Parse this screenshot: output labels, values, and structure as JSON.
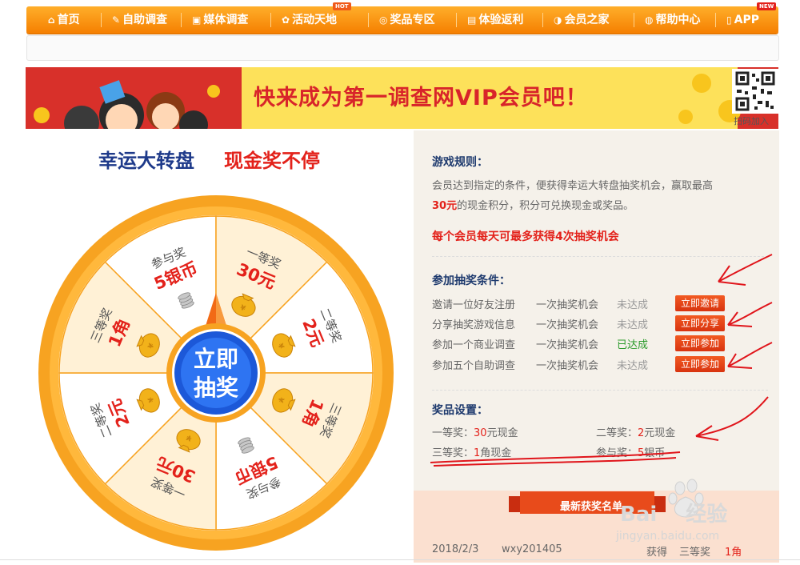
{
  "nav": {
    "items": [
      {
        "label": "首页",
        "icon": "home-icon"
      },
      {
        "label": "自助调查",
        "icon": "pencil-icon"
      },
      {
        "label": "媒体调查",
        "icon": "tv-icon"
      },
      {
        "label": "活动天地",
        "icon": "gift-icon",
        "badge": "HOT"
      },
      {
        "label": "奖品专区",
        "icon": "coins-icon"
      },
      {
        "label": "体验返利",
        "icon": "wallet-icon"
      },
      {
        "label": "会员之家",
        "icon": "members-icon"
      },
      {
        "label": "帮助中心",
        "icon": "help-icon"
      },
      {
        "label": "APP",
        "icon": "phone-icon",
        "badge": "NEW"
      }
    ]
  },
  "banner": {
    "headline": "快来成为第一调查网VIP会员吧！",
    "qr_caption": "扫码加入"
  },
  "wheel": {
    "title": "幸运大转盘",
    "slogan": "现金奖不停",
    "center_button": [
      "立即",
      "抽奖"
    ],
    "segments": [
      {
        "tier": "参与奖",
        "prize": "5银币"
      },
      {
        "tier": "一等奖",
        "prize": "30元"
      },
      {
        "tier": "二等奖",
        "prize": "2元"
      },
      {
        "tier": "三等奖",
        "prize": "1角"
      },
      {
        "tier": "参与奖",
        "prize": "5银币"
      },
      {
        "tier": "一等奖",
        "prize": "30元"
      },
      {
        "tier": "二等奖",
        "prize": "2元"
      },
      {
        "tier": "三等奖",
        "prize": "1角"
      }
    ]
  },
  "rules": {
    "heading": "游戏规则：",
    "line1": "会员达到指定的条件，便获得幸运大转盘抽奖机会，赢取最高",
    "line2_amount": "30元",
    "line2_rest": "的现金积分，积分可兑换现金或奖品。",
    "highlight": "每个会员每天可最多获得4次抽奖机会"
  },
  "conditions": {
    "heading": "参加抽奖条件：",
    "rows": [
      {
        "task": "邀请一位好友注册",
        "reward": "一次抽奖机会",
        "status": "未达成",
        "done": false,
        "button": "立即邀请"
      },
      {
        "task": "分享抽奖游戏信息",
        "reward": "一次抽奖机会",
        "status": "未达成",
        "done": false,
        "button": "立即分享"
      },
      {
        "task": "参加一个商业调查",
        "reward": "一次抽奖机会",
        "status": "已达成",
        "done": true,
        "button": "立即参加"
      },
      {
        "task": "参加五个自助调查",
        "reward": "一次抽奖机会",
        "status": "未达成",
        "done": false,
        "button": "立即参加"
      }
    ]
  },
  "prizes": {
    "heading": "奖品设置：",
    "items": [
      {
        "label": "一等奖：",
        "value": "30",
        "unit": "元现金"
      },
      {
        "label": "二等奖：",
        "value": "2",
        "unit": "元现金"
      },
      {
        "label": "三等奖：",
        "value": "1",
        "unit": "角现金"
      },
      {
        "label": "参与奖：",
        "value": "5",
        "unit": "银币"
      }
    ]
  },
  "winners": {
    "heading": "最新获奖名单",
    "rows": [
      {
        "date": "2018/2/3",
        "user": "wxy201405",
        "verb": "获得",
        "tier": "三等奖",
        "prize": "1角"
      }
    ]
  },
  "watermark": {
    "brand": "Bai",
    "brand_cn": "经验",
    "url": "jingyan.baidu.com"
  },
  "colors": {
    "nav_orange": "#f89a10",
    "accent_red": "#e3221b",
    "title_blue": "#1e3a8a",
    "status_green": "#2a9a2a"
  }
}
